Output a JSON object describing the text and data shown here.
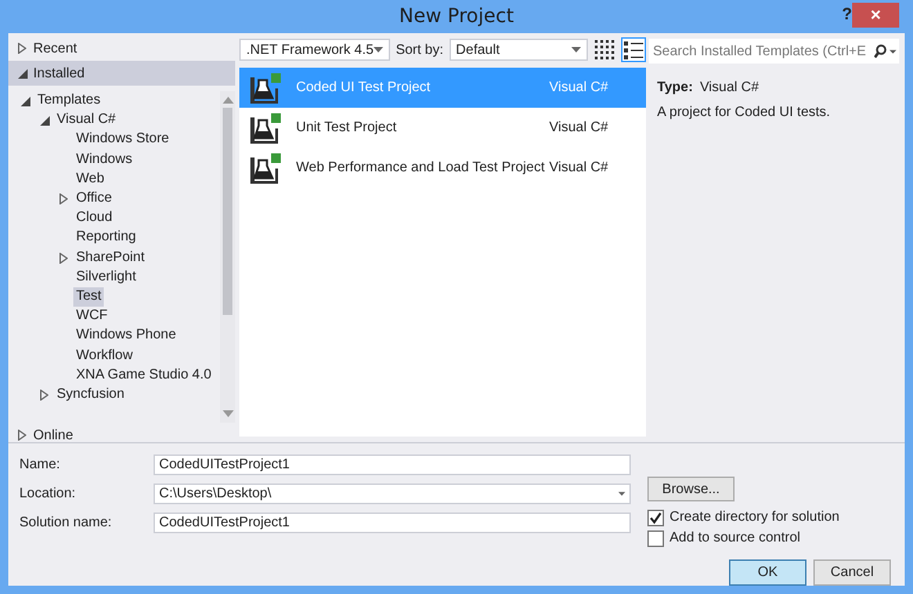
{
  "window": {
    "title": "New Project",
    "help": "?",
    "close": "×"
  },
  "sidebar": {
    "items": [
      {
        "label": "Recent",
        "expanded": false,
        "selected": false
      },
      {
        "label": "Installed",
        "expanded": true,
        "selected": true,
        "children": [
          {
            "label": "Templates",
            "expanded": true,
            "selected": false,
            "children": [
              {
                "label": "Visual C#",
                "expanded": true,
                "selected": false,
                "children": [
                  {
                    "label": "Windows Store",
                    "selected": false
                  },
                  {
                    "label": "Windows",
                    "selected": false
                  },
                  {
                    "label": "Web",
                    "selected": false
                  },
                  {
                    "label": "Office",
                    "expanded": false,
                    "selected": false
                  },
                  {
                    "label": "Cloud",
                    "selected": false
                  },
                  {
                    "label": "Reporting",
                    "selected": false
                  },
                  {
                    "label": "SharePoint",
                    "expanded": false,
                    "selected": false
                  },
                  {
                    "label": "Silverlight",
                    "selected": false
                  },
                  {
                    "label": "Test",
                    "selected": true
                  },
                  {
                    "label": "WCF",
                    "selected": false
                  },
                  {
                    "label": "Windows Phone",
                    "selected": false
                  },
                  {
                    "label": "Workflow",
                    "selected": false
                  },
                  {
                    "label": "XNA Game Studio 4.0",
                    "selected": false
                  }
                ]
              },
              {
                "label": "Syncfusion",
                "expanded": false,
                "selected": false
              }
            ]
          }
        ]
      },
      {
        "label": "Online",
        "expanded": false,
        "selected": false
      }
    ]
  },
  "toolbar": {
    "framework": ".NET Framework 4.5",
    "sort_label": "Sort by:",
    "sort": "Default",
    "views": [
      {
        "kind": "grid",
        "selected": false
      },
      {
        "kind": "list",
        "selected": true
      }
    ],
    "search_placeholder": "Search Installed Templates (Ctrl+E"
  },
  "templates": [
    {
      "name": "Coded UI Test Project",
      "language": "Visual C#",
      "selected": true
    },
    {
      "name": "Unit Test Project",
      "language": "Visual C#",
      "selected": false
    },
    {
      "name": "Web Performance and Load Test Project",
      "language": "Visual C#",
      "selected": false
    }
  ],
  "details": {
    "type_label": "Type:",
    "type": "Visual C#",
    "description": "A project for Coded UI tests."
  },
  "form": {
    "name_label": "Name:",
    "name": "CodedUITestProject1",
    "location_label": "Location:",
    "location": "C:\\Users\\Desktop\\",
    "solution_label": "Solution name:",
    "solution": "CodedUITestProject1",
    "browse": "Browse..."
  },
  "options": [
    {
      "label": "Create directory for solution",
      "checked": true
    },
    {
      "label": "Add to source control",
      "checked": false
    }
  ],
  "buttons": [
    {
      "label": "OK",
      "default": true
    },
    {
      "label": "Cancel",
      "default": false
    }
  ]
}
